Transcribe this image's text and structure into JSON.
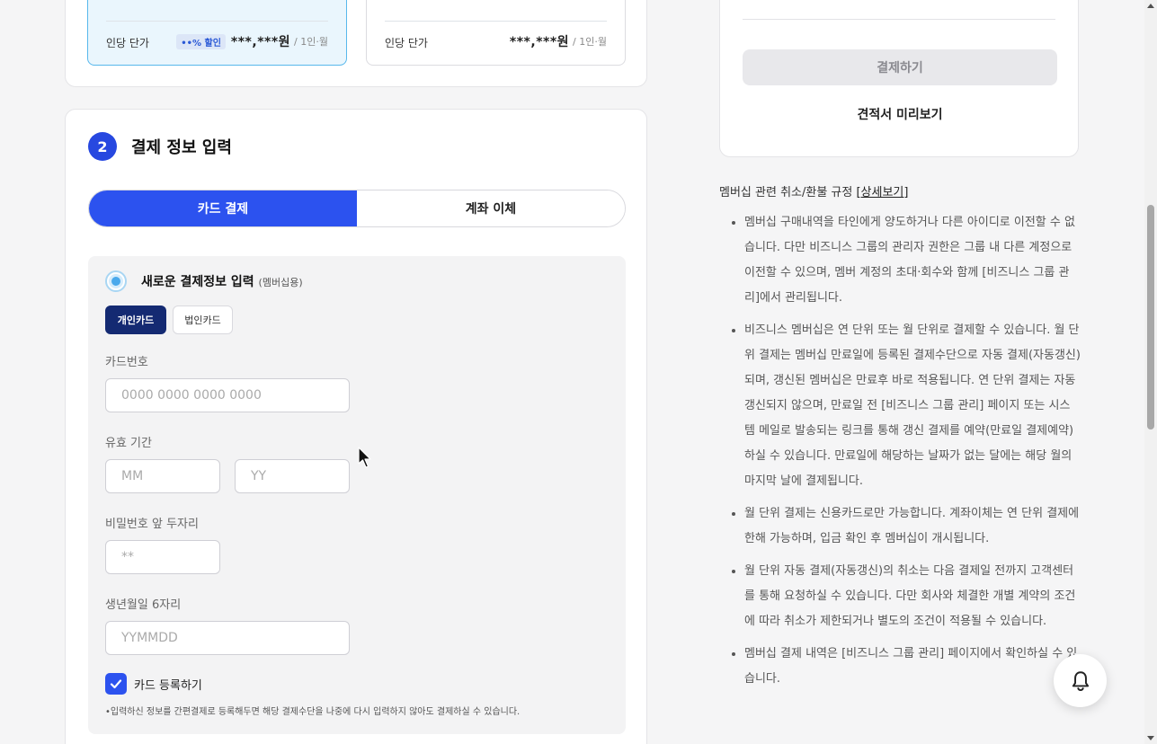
{
  "plans": [
    {
      "per_person_label": "인당 단가",
      "discount_badge": "••% 할인",
      "price": "***,***원",
      "unit": "/ 1인·월",
      "selected": true
    },
    {
      "per_person_label": "인당 단가",
      "price": "***,***원",
      "unit": "/ 1인·월",
      "selected": false
    }
  ],
  "payment": {
    "step_number": "2",
    "title": "결제 정보 입력",
    "tabs": [
      {
        "label": "카드 결제",
        "active": true
      },
      {
        "label": "계좌 이체",
        "active": false
      }
    ],
    "new_payment_title": "새로운 결제정보 입력",
    "new_payment_sub": "(멤버십용)",
    "card_types": [
      "개인카드",
      "법인카드"
    ],
    "card_number_label": "카드번호",
    "card_number_placeholder": "0000 0000 0000 0000",
    "expiry_label": "유효 기간",
    "expiry_month_placeholder": "MM",
    "expiry_year_placeholder": "YY",
    "password_label": "비밀번호 앞 두자리",
    "password_placeholder": "**",
    "birth_label": "생년월일 6자리",
    "birth_placeholder": "YYMMDD",
    "register_card_label": "카드 등록하기",
    "register_card_checked": true,
    "note": "•입력하신 정보를 간편결제로 등록해두면 해당 결제수단을 나중에 다시 입력하지 않아도 결제하실 수 있습니다."
  },
  "summary": {
    "pay_button": "결제하기",
    "quote_button": "견적서 미리보기"
  },
  "policy": {
    "heading": "멤버십 관련 취소/환불 규정",
    "detail_link": "[상세보기]",
    "items": [
      "멤버십 구매내역을 타인에게 양도하거나 다른 아이디로 이전할 수 없습니다. 다만 비즈니스 그룹의 관리자 권한은 그룹 내 다른 계정으로 이전할 수 있으며, 멤버 계정의 초대·회수와 함께 [비즈니스 그룹 관리]에서 관리됩니다.",
      "비즈니스 멤버십은 연 단위 또는 월 단위로 결제할 수 있습니다. 월 단위 결제는 멤버십 만료일에 등록된 결제수단으로 자동 결제(자동갱신)되며, 갱신된 멤버십은 만료후 바로 적용됩니다. 연 단위 결제는 자동 갱신되지 않으며, 만료일 전 [비즈니스 그룹 관리] 페이지 또는 시스템 메일로 발송되는 링크를 통해 갱신 결제를 예약(만료일 결제예약)하실 수 있습니다. 만료일에 해당하는 날짜가 없는 달에는 해당 월의 마지막 날에 결제됩니다.",
      "월 단위 결제는 신용카드로만 가능합니다. 계좌이체는 연 단위 결제에 한해 가능하며, 입금 확인 후 멤버십이 개시됩니다.",
      "월 단위 자동 결제(자동갱신)의 취소는 다음 결제일 전까지 고객센터를 통해 요청하실 수 있습니다. 다만 회사와 체결한 개별 계약의 조건에 따라 취소가 제한되거나 별도의 조건이 적용될 수 있습니다.",
      "멤버십 결제 내역은 [비즈니스 그룹 관리] 페이지에서 확인하실 수 있습니다."
    ]
  },
  "colors": {
    "accent": "#2c52ef",
    "dark_navy": "#142a72",
    "selected_plan_bg": "#eaf6fd"
  },
  "icons": [
    "bell-icon",
    "check-icon",
    "radio-icon",
    "cursor-icon"
  ]
}
